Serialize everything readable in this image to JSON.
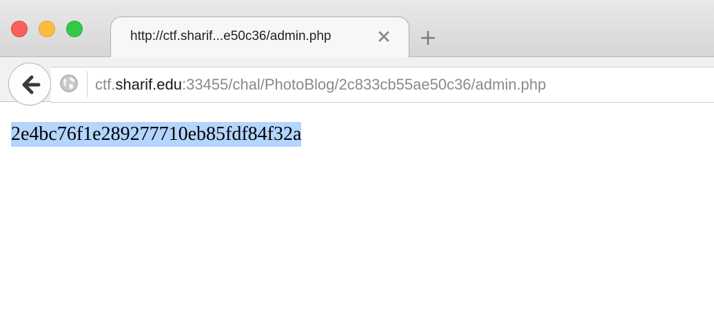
{
  "window": {
    "controls": [
      "close",
      "minimize",
      "maximize"
    ],
    "colors": {
      "close": "#fc605c",
      "minimize": "#fdbc40",
      "maximize": "#34c84a"
    }
  },
  "tab": {
    "title": "http://ctf.sharif...e50c36/admin.php",
    "close_icon": "close-icon",
    "new_tab_icon": "plus-icon"
  },
  "navbar": {
    "back_icon": "arrow-left-icon",
    "site_icon": "globe-icon",
    "url": {
      "prefix": "ctf.",
      "domain": "sharif.edu",
      "rest": ":33455/chal/PhotoBlog/2c833cb55ae50c36/admin.php"
    }
  },
  "page": {
    "text": "2e4bc76f1e289277710eb85fdf84f32a",
    "selection_color": "#b4d5fe"
  }
}
